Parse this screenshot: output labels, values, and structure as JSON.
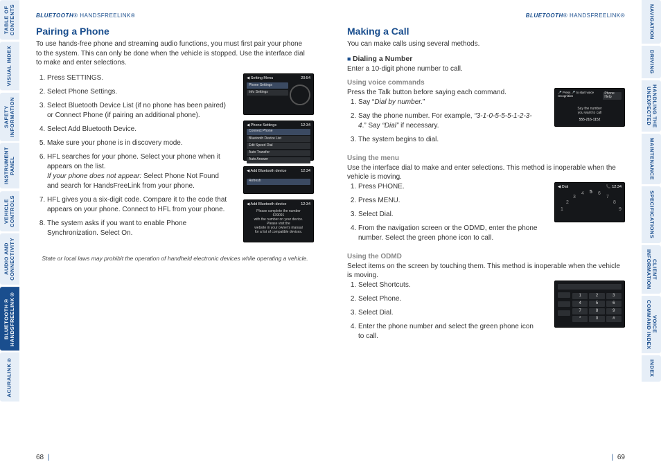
{
  "runningHead": {
    "bt": "BLUETOOTH",
    "reg": "®",
    "hfl": " HANDSFREELINK",
    "reg2": "®"
  },
  "leftTabs": [
    {
      "label": "TABLE OF\nCONTENTS",
      "active": false
    },
    {
      "label": "VISUAL INDEX",
      "active": false
    },
    {
      "label": "SAFETY\nINFORMATION",
      "active": false
    },
    {
      "label": "INSTRUMENT\nPANEL",
      "active": false
    },
    {
      "label": "VEHICLE\nCONTROLS",
      "active": false
    },
    {
      "label": "AUDIO AND\nCONNECTIVITY",
      "active": false
    },
    {
      "label": "BLUETOOTH®\nHANDSFREELINK®",
      "active": true
    },
    {
      "label": "ACURALINK®",
      "active": false
    }
  ],
  "rightTabs": [
    {
      "label": "NAVIGATION",
      "active": false
    },
    {
      "label": "DRIVING",
      "active": false
    },
    {
      "label": "HANDLING THE\nUNEXPECTED",
      "active": false
    },
    {
      "label": "MAINTENANCE",
      "active": false
    },
    {
      "label": "SPECIFICATIONS",
      "active": false
    },
    {
      "label": "CLIENT\nINFORMATION",
      "active": false
    },
    {
      "label": "VOICE\nCOMMAND INDEX",
      "active": false
    },
    {
      "label": "INDEX",
      "active": false
    }
  ],
  "left": {
    "title": "Pairing a Phone",
    "intro": "To use hands-free phone and streaming audio functions, you must first pair your phone to the system. This can only be done when the vehicle is stopped. Use the interface dial to make and enter selections.",
    "steps": [
      "Press SETTINGS.",
      "Select Phone Settings.",
      "Select Bluetooth Device List (if no phone has been paired) or Connect Phone (if pairing an additional phone).",
      "Select Add Bluetooth Device.",
      "Make sure your phone is in discovery mode.",
      "HFL searches for your phone. Select your phone when it appears on the list.",
      " HFL gives you a six-digit code. Compare it to the code that appears on your phone. Connect to HFL from your phone.",
      "The system asks if you want to enable Phone Synchronization. Select On."
    ],
    "step6note_label": "If your phone does not appear:",
    "step6note_text": " Select Phone Not Found and search for HandsFreeLink from your phone.",
    "disclaimer": "State or local laws may prohibit the operation of handheld electronic devices while operating a vehicle.",
    "pageNum": "68",
    "shots": {
      "a": {
        "title": "Setting Menu",
        "clock": "20:54",
        "items": [
          "Phone Settings",
          "Info Settings"
        ]
      },
      "b": {
        "title": "Phone Settings",
        "clock": "12:34",
        "items": [
          "Connect Phone",
          "Bluetooth Device List",
          "Edit Speed Dial",
          "Auto Transfer",
          "Auto Answer"
        ]
      },
      "c": {
        "title": "Add Bluetooth device",
        "clock": "12:34",
        "item": "Refresh"
      },
      "d": {
        "title": "Add Bluetooth device",
        "clock": "12:34",
        "msg": "Please complete the number\n639091\nwith the number on your device. Please visit the\nwebsite in your owner's manual\nfor a list of compatible devices."
      }
    }
  },
  "right": {
    "title": "Making a Call",
    "intro": "You can make calls using several methods.",
    "sub1": "Dialing a Number",
    "sub1text": "Enter a 10-digit phone number to call.",
    "m1": {
      "head": "Using voice commands",
      "lead": "Press the Talk button before saying each command.",
      "steps": [
        "Say “",
        "Say the phone number. For example, ",
        "The system begins to dial."
      ],
      "s1_it": "Dial by number.",
      "s1_end": "”",
      "example_pre": "“",
      "example_it": "3-1-0-5-5-5-1-2-3-4",
      "example_mid": ".” Say ",
      "example_it2": "“Dial”",
      "example_end": " if necessary."
    },
    "m2": {
      "head": "Using the menu",
      "lead": "Use the interface dial to make and enter selections. This method is inoperable when the vehicle is moving.",
      "steps": [
        "Press PHONE.",
        "Press MENU.",
        "Select Dial.",
        "From the navigation screen or the ODMD, enter the phone number. Select the green phone icon to call."
      ]
    },
    "m3": {
      "head": "Using the ODMD",
      "lead": "Select items on the screen by touching them. This method is inoperable when the vehicle is moving.",
      "steps": [
        "Select Shortcuts.",
        "Select Phone.",
        "Select Dial.",
        "Enter the phone number and select the green phone icon to call."
      ]
    },
    "pageNum": "69",
    "shots": {
      "e": {
        "top": "Press 🎤 to start voice recognition",
        "btn": "Phone Help",
        "msg": "Say the number\nyou want to call",
        "num": "555-216-1152"
      },
      "f": {
        "title": "Dial",
        "clock": "12:34",
        "digits": [
          "1",
          "2",
          "3",
          "4",
          "5",
          "6",
          "7",
          "8",
          "9",
          "0"
        ]
      },
      "g": {
        "keys": [
          "1",
          "2",
          "3",
          "4",
          "5",
          "6",
          "7",
          "8",
          "9",
          "*",
          "0",
          "#"
        ]
      }
    }
  }
}
